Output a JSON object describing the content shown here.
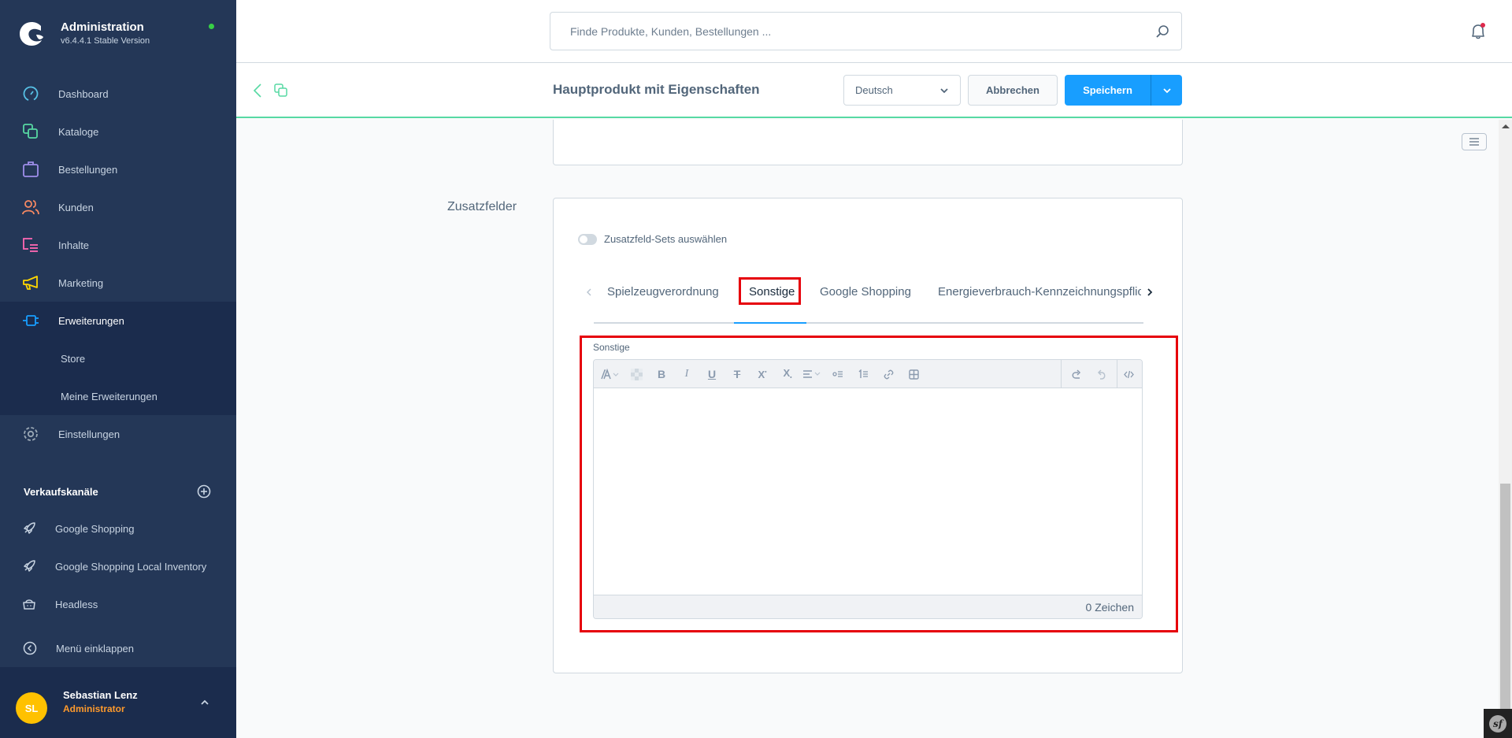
{
  "app": {
    "title": "Administration",
    "version": "v6.4.4.1 Stable Version",
    "status_color": "#37d046"
  },
  "sidebar": {
    "items": [
      {
        "label": "Dashboard",
        "icon": "gauge-icon",
        "color": "#57c1e6"
      },
      {
        "label": "Kataloge",
        "icon": "catalog-icon",
        "color": "#57d9a3"
      },
      {
        "label": "Bestellungen",
        "icon": "shopping-bag-icon",
        "color": "#9f8eeb"
      },
      {
        "label": "Kunden",
        "icon": "users-icon",
        "color": "#f88962"
      },
      {
        "label": "Inhalte",
        "icon": "content-icon",
        "color": "#ff68b4"
      },
      {
        "label": "Marketing",
        "icon": "megaphone-icon",
        "color": "#ffd700"
      },
      {
        "label": "Erweiterungen",
        "icon": "plug-icon",
        "color": "#189eff",
        "active": true
      },
      {
        "label": "Einstellungen",
        "icon": "gear-icon",
        "color": "#9aa8b5"
      }
    ],
    "sub_items": [
      {
        "label": "Store"
      },
      {
        "label": "Meine Erweiterungen"
      }
    ],
    "sales_channels_title": "Verkaufskanäle",
    "sales_channels": [
      {
        "label": "Google Shopping",
        "icon": "rocket-icon"
      },
      {
        "label": "Google Shopping Local Inventory",
        "icon": "rocket-icon"
      },
      {
        "label": "Headless",
        "icon": "basket-icon"
      }
    ],
    "collapse_label": "Menü einklappen",
    "user": {
      "initials": "SL",
      "name": "Sebastian Lenz",
      "role": "Administrator"
    }
  },
  "header": {
    "search_placeholder": "Finde Produkte, Kunden, Bestellungen ...",
    "has_notification": true
  },
  "smartbar": {
    "title": "Hauptprodukt mit Eigenschaften",
    "language": "Deutsch",
    "cancel_label": "Abbrechen",
    "save_label": "Speichern"
  },
  "custom_fields": {
    "section_label": "Zusatzfelder",
    "toggle_label": "Zusatzfeld-Sets auswählen",
    "toggle_on": false,
    "tabs": [
      {
        "label": "Spielzeugverordnung"
      },
      {
        "label": "Sonstige",
        "active": true
      },
      {
        "label": "Google Shopping"
      },
      {
        "label": "Energieverbrauch-Kennzeichnungspflicht"
      }
    ],
    "field_label": "Sonstige",
    "editor_value": "",
    "char_count": "0 Zeichen"
  },
  "highlight_color": "#e6000a"
}
